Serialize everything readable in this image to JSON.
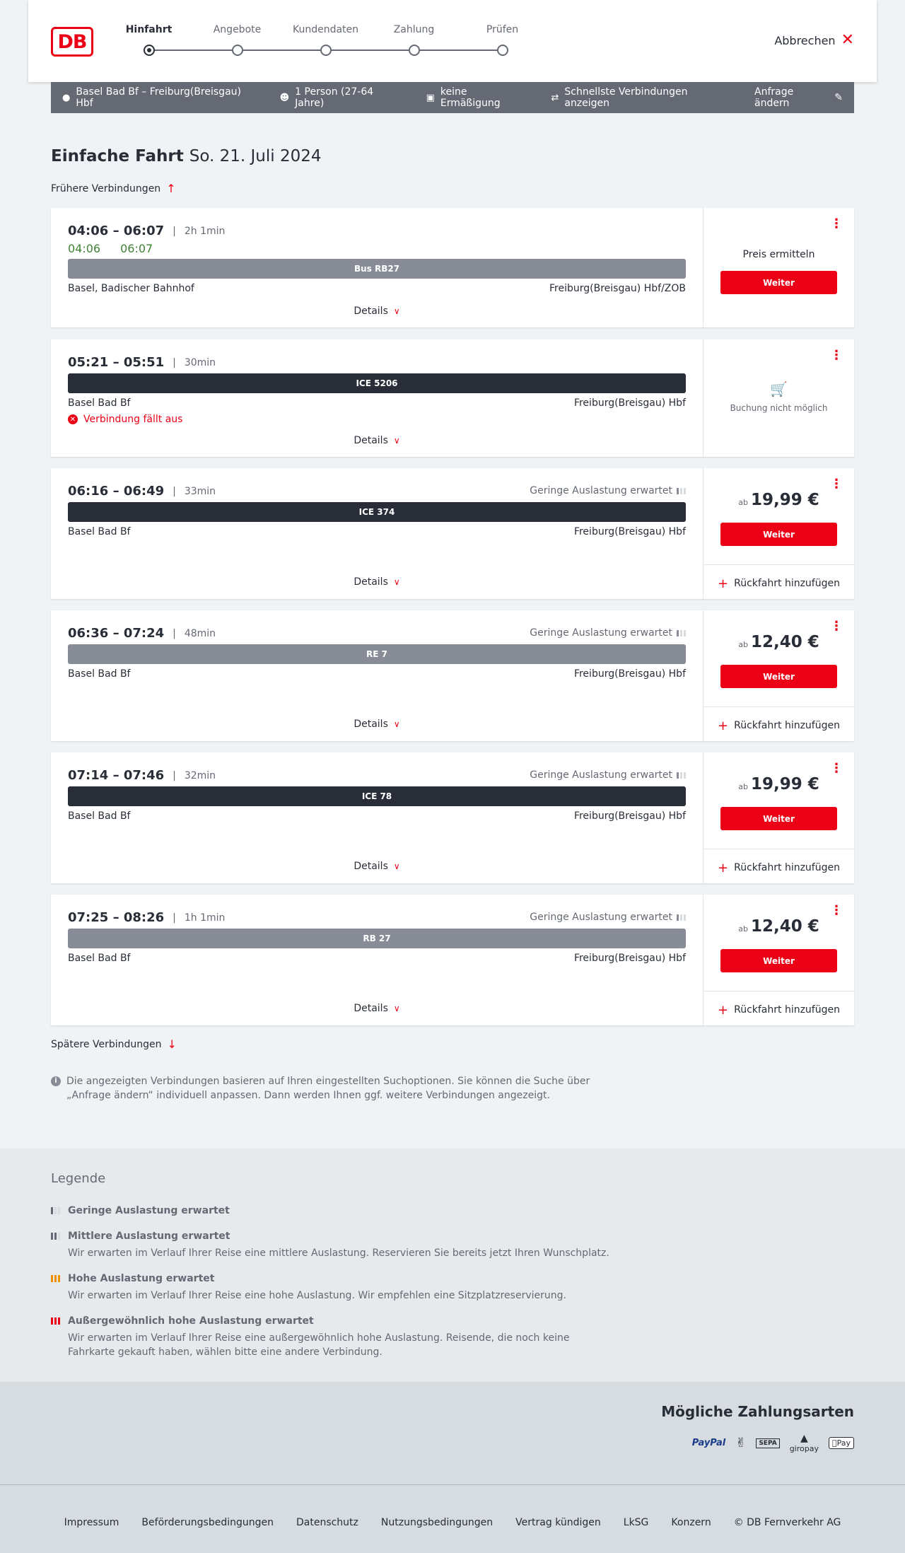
{
  "header": {
    "logo": "DB",
    "steps": [
      {
        "label": "Hinfahrt",
        "active": true
      },
      {
        "label": "Angebote",
        "active": false
      },
      {
        "label": "Kundendaten",
        "active": false
      },
      {
        "label": "Zahlung",
        "active": false
      },
      {
        "label": "Prüfen",
        "active": false
      }
    ],
    "cancel_label": "Abbrechen"
  },
  "search": {
    "route": "Basel Bad Bf – Freiburg(Breisgau) Hbf",
    "travellers": "1 Person (27-64 Jahre)",
    "discount": "keine Ermäßigung",
    "option": "Schnellste Verbindungen anzeigen",
    "change_label": "Anfrage ändern"
  },
  "title": {
    "main": "Einfache Fahrt",
    "date": "So. 21. Juli 2024"
  },
  "earlier_label": "Frühere Verbindungen",
  "later_label": "Spätere Verbindungen",
  "details_label": "Details",
  "weiter_label": "Weiter",
  "return_label": "Rückfahrt hinzufügen",
  "price_prefix": "ab",
  "connections": [
    {
      "times": "04:06 – 06:07",
      "duration": "2h 1min",
      "rt_dep": "04:06",
      "rt_arr": "06:07",
      "train": "Bus RB27",
      "from": "Basel, Badischer Bahnhof",
      "to": "Freiburg(Breisgau) Hbf/ZOB",
      "price_label": "Preis ermitteln"
    },
    {
      "times": "05:21 – 05:51",
      "duration": "30min",
      "train": "ICE 5206",
      "from": "Basel Bad Bf",
      "to": "Freiburg(Breisgau) Hbf",
      "cancelled": "Verbindung fällt aus",
      "not_bookable": "Buchung nicht möglich"
    },
    {
      "times": "06:16 – 06:49",
      "duration": "33min",
      "occupancy": "Geringe Auslastung erwartet",
      "train": "ICE 374",
      "from": "Basel Bad Bf",
      "to": "Freiburg(Breisgau) Hbf",
      "price": "19,99 €"
    },
    {
      "times": "06:36 – 07:24",
      "duration": "48min",
      "occupancy": "Geringe Auslastung erwartet",
      "train": "RE 7",
      "from": "Basel Bad Bf",
      "to": "Freiburg(Breisgau) Hbf",
      "price": "12,40 €"
    },
    {
      "times": "07:14 – 07:46",
      "duration": "32min",
      "occupancy": "Geringe Auslastung erwartet",
      "train": "ICE 78",
      "from": "Basel Bad Bf",
      "to": "Freiburg(Breisgau) Hbf",
      "price": "19,99 €"
    },
    {
      "times": "07:25 – 08:26",
      "duration": "1h 1min",
      "occupancy": "Geringe Auslastung erwartet",
      "train": "RB 27",
      "from": "Basel Bad Bf",
      "to": "Freiburg(Breisgau) Hbf",
      "price": "12,40 €"
    }
  ],
  "info_text": "Die angezeigten Verbindungen basieren auf Ihren eingestellten Suchoptionen. Sie können die Suche über „Anfrage ändern“ individuell anpassen. Dann werden Ihnen ggf. weitere Verbindungen angezeigt.",
  "legend": {
    "title": "Legende",
    "items": [
      {
        "head": "Geringe Auslastung erwartet",
        "desc": ""
      },
      {
        "head": "Mittlere Auslastung erwartet",
        "desc": "Wir erwarten im Verlauf Ihrer Reise eine mittlere Auslastung. Reservieren Sie bereits jetzt Ihren Wunschplatz."
      },
      {
        "head": "Hohe Auslastung erwartet",
        "desc": "Wir erwarten im Verlauf Ihrer Reise eine hohe Auslastung. Wir empfehlen eine Sitzplatzreservierung."
      },
      {
        "head": "Außergewöhnlich hohe Auslastung erwartet",
        "desc": "Wir erwarten im Verlauf Ihrer Reise eine außergewöhnlich hohe Auslastung. Reisende, die noch keine Fahrkarte gekauft haben, wählen bitte eine andere Verbindung."
      }
    ]
  },
  "payment": {
    "title": "Mögliche Zahlungsarten",
    "paypal": "PayPal",
    "sepa": "SEPA",
    "giropay": "giropay",
    "applepay": "Pay"
  },
  "footer": {
    "links": [
      "Impressum",
      "Beförderungsbedingungen",
      "Datenschutz",
      "Nutzungsbedingungen",
      "Vertrag kündigen",
      "LkSG",
      "Konzern"
    ],
    "copyright": "© DB Fernverkehr AG"
  },
  "colors": {
    "accent": "#ec0016",
    "realtime": "#408335",
    "bar_dark": "#282d37",
    "bar_grey": "#878c96",
    "occ_medium": "#878c96",
    "occ_high": "#f39200",
    "occ_extreme": "#ec0016"
  }
}
